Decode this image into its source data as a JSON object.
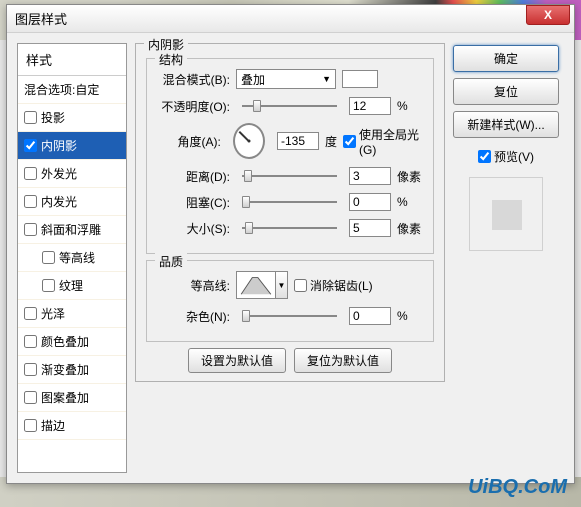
{
  "window": {
    "title": "图层样式"
  },
  "close_x": "X",
  "style_list": {
    "header": "样式",
    "items": [
      {
        "label": "混合选项:自定",
        "check": false,
        "hasCheck": false
      },
      {
        "label": "投影",
        "check": false,
        "hasCheck": true
      },
      {
        "label": "内阴影",
        "check": true,
        "hasCheck": true,
        "selected": true
      },
      {
        "label": "外发光",
        "check": false,
        "hasCheck": true
      },
      {
        "label": "内发光",
        "check": false,
        "hasCheck": true
      },
      {
        "label": "斜面和浮雕",
        "check": false,
        "hasCheck": true
      },
      {
        "label": "等高线",
        "check": false,
        "hasCheck": true,
        "indent": true
      },
      {
        "label": "纹理",
        "check": false,
        "hasCheck": true,
        "indent": true
      },
      {
        "label": "光泽",
        "check": false,
        "hasCheck": true
      },
      {
        "label": "颜色叠加",
        "check": false,
        "hasCheck": true
      },
      {
        "label": "渐变叠加",
        "check": false,
        "hasCheck": true
      },
      {
        "label": "图案叠加",
        "check": false,
        "hasCheck": true
      },
      {
        "label": "描边",
        "check": false,
        "hasCheck": true
      }
    ]
  },
  "panel": {
    "title": "内阴影",
    "structure": {
      "title": "结构",
      "blend_mode": {
        "label": "混合模式(B):",
        "value": "叠加"
      },
      "opacity": {
        "label": "不透明度(O):",
        "value": "12",
        "unit": "%",
        "pos": 12
      },
      "angle": {
        "label": "角度(A):",
        "value": "-135",
        "unit": "度",
        "global": {
          "label": "使用全局光(G)",
          "checked": true
        }
      },
      "distance": {
        "label": "距离(D):",
        "value": "3",
        "unit": "像素",
        "pos": 2
      },
      "choke": {
        "label": "阻塞(C):",
        "value": "0",
        "unit": "%",
        "pos": 0
      },
      "size": {
        "label": "大小(S):",
        "value": "5",
        "unit": "像素",
        "pos": 3
      }
    },
    "quality": {
      "title": "品质",
      "contour": {
        "label": "等高线:",
        "anti": {
          "label": "消除锯齿(L)",
          "checked": false
        }
      },
      "noise": {
        "label": "杂色(N):",
        "value": "0",
        "unit": "%",
        "pos": 0
      }
    },
    "buttons": {
      "default": "设置为默认值",
      "reset": "复位为默认值"
    }
  },
  "right": {
    "ok": "确定",
    "cancel": "复位",
    "newstyle": "新建样式(W)...",
    "preview": {
      "label": "预览(V)",
      "checked": true
    }
  },
  "watermark": "UiBQ.CoM"
}
